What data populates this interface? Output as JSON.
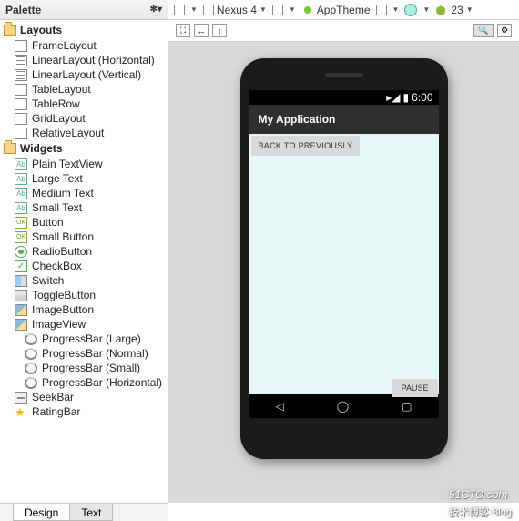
{
  "palette": {
    "title": "Palette",
    "categories": [
      {
        "label": "Layouts",
        "items": [
          "FrameLayout",
          "LinearLayout (Horizontal)",
          "LinearLayout (Vertical)",
          "TableLayout",
          "TableRow",
          "GridLayout",
          "RelativeLayout"
        ]
      },
      {
        "label": "Widgets",
        "items": [
          "Plain TextView",
          "Large Text",
          "Medium Text",
          "Small Text",
          "Button",
          "Small Button",
          "RadioButton",
          "CheckBox",
          "Switch",
          "ToggleButton",
          "ImageButton",
          "ImageView",
          "ProgressBar (Large)",
          "ProgressBar (Normal)",
          "ProgressBar (Small)",
          "ProgressBar (Horizontal)",
          "SeekBar",
          "RatingBar"
        ]
      }
    ]
  },
  "tabs": {
    "design": "Design",
    "text": "Text"
  },
  "toolbar": {
    "device": "Nexus 4",
    "theme": "AppTheme",
    "api": "23"
  },
  "device": {
    "status_time": "6:00",
    "app_title": "My Application",
    "back_btn": "BACK TO PREVIOUSLY",
    "pause_btn": "PAUSE"
  },
  "watermark": {
    "main": "51CTO.com",
    "sub": "技术博客   Blog"
  }
}
